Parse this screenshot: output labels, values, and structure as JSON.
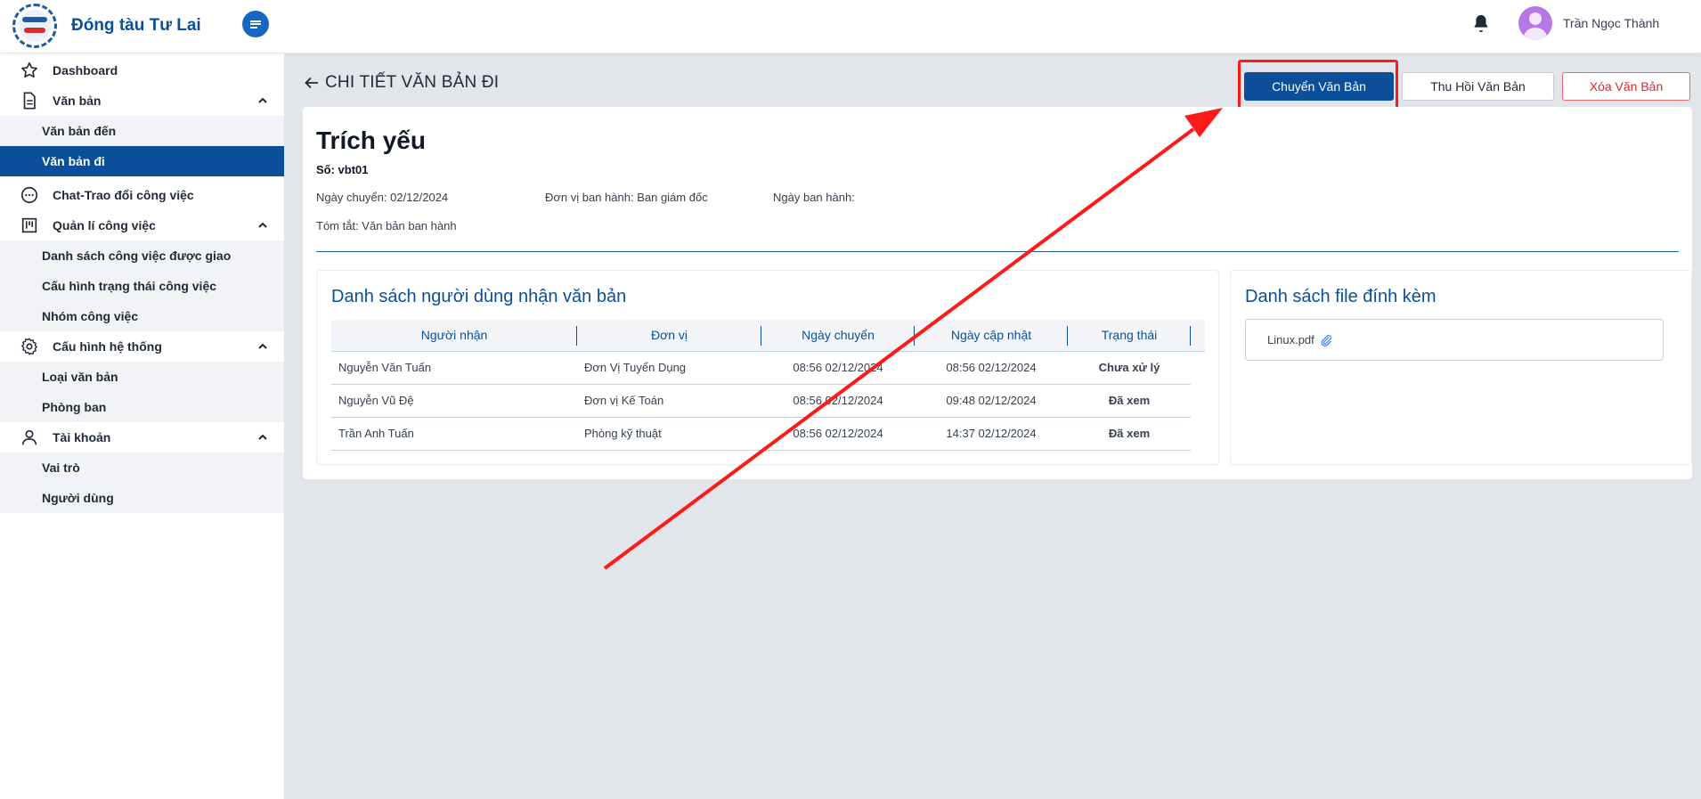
{
  "app": {
    "brand_name": "Đóng tàu Tư Lai",
    "user_name": "Trần Ngọc Thành"
  },
  "sidebar": {
    "dashboard": "Dashboard",
    "documents": {
      "label": "Văn bản",
      "items": [
        "Văn bản đến",
        "Văn bản đi"
      ]
    },
    "chat": "Chat-Trao đổi công việc",
    "tasks": {
      "label": "Quản lí công việc",
      "items": [
        "Danh sách công việc được giao",
        "Cấu hình trạng thái công việc",
        "Nhóm công việc"
      ]
    },
    "config": {
      "label": "Cấu hình hệ thống",
      "items": [
        "Loại văn bản",
        "Phòng ban"
      ]
    },
    "account": {
      "label": "Tài khoản",
      "items": [
        "Vai trò",
        "Người dùng"
      ]
    },
    "active_item": "Văn bản đi"
  },
  "page": {
    "title": "CHI TIẾT VĂN BẢN ĐI",
    "actions": {
      "forward": "Chuyển Văn Bản",
      "recall": "Thu Hồi Văn Bản",
      "delete": "Xóa Văn Bản"
    }
  },
  "document": {
    "summary_title": "Trích yếu",
    "number": "Số: vbt01",
    "transfer_date": "Ngày chuyển: 02/12/2024",
    "issuing_unit": "Đơn vị ban hành: Ban giám đốc",
    "issue_date": "Ngày ban hành:",
    "summary": "Tóm tắt: Văn bản ban hành"
  },
  "recipients": {
    "title": "Danh sách người dùng nhận văn bản",
    "columns": [
      "Người nhận",
      "Đơn vị",
      "Ngày chuyển",
      "Ngày cập nhật",
      "Trạng thái"
    ],
    "rows": [
      {
        "name": "Nguyễn Văn Tuấn",
        "unit": "Đơn Vị Tuyển Dụng",
        "sent": "08:56 02/12/2024",
        "updated": "08:56 02/12/2024",
        "status": "Chưa xử lý"
      },
      {
        "name": "Nguyễn Vũ Đệ",
        "unit": "Đơn vị Kế Toán",
        "sent": "08:56 02/12/2024",
        "updated": "09:48 02/12/2024",
        "status": "Đã xem"
      },
      {
        "name": "Trần Anh Tuấn",
        "unit": "Phòng kỹ thuật",
        "sent": "08:56 02/12/2024",
        "updated": "14:37 02/12/2024",
        "status": "Đã xem"
      }
    ]
  },
  "attachments": {
    "title": "Danh sách file đính kèm",
    "files": [
      "Linux.pdf"
    ]
  },
  "colors": {
    "primary": "#0b4f9a",
    "danger": "#e0262b",
    "status_unread": "#1d2ed6",
    "status_read": "#0f7b15",
    "annotation": "#ff1a1a"
  },
  "icons": {
    "menu": "menu-toggle-icon",
    "bell": "bell-icon",
    "back": "arrow-left-icon",
    "attachment": "paperclip-icon"
  }
}
